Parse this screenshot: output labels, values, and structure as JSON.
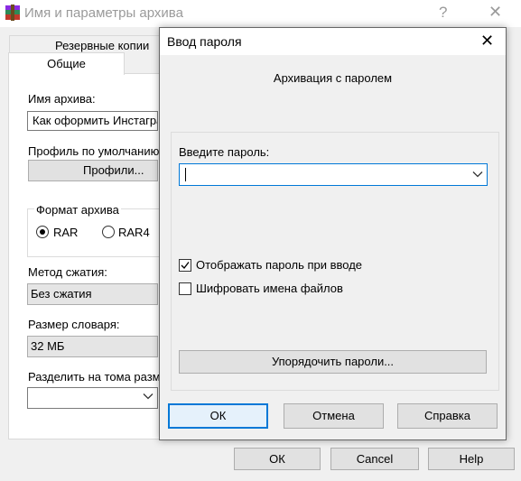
{
  "background_dialog": {
    "title": "Имя и параметры архива",
    "help_glyph": "?",
    "close_glyph": "✕",
    "tabs": [
      {
        "label": "Резервные копии"
      },
      {
        "label": "Общие"
      }
    ],
    "archive_name": {
      "label": "Имя архива:",
      "value": "Как оформить Инстагра"
    },
    "default_profile": {
      "label": "Профиль по умолчанию",
      "button_label": "Профили..."
    },
    "archive_format": {
      "label": "Формат архива",
      "options": [
        {
          "label": "RAR",
          "selected": true
        },
        {
          "label": "RAR4",
          "selected": false
        }
      ]
    },
    "compression_method": {
      "label": "Метод сжатия:",
      "value": "Без сжатия"
    },
    "dictionary_size": {
      "label": "Размер словаря:",
      "value": "32 МБ"
    },
    "split_volumes": {
      "label": "Разделить на тома разме",
      "value": ""
    },
    "buttons": {
      "ok": "ОК",
      "cancel": "Cancel",
      "help": "Help"
    }
  },
  "password_dialog": {
    "title": "Ввод пароля",
    "close_glyph": "✕",
    "subtitle": "Архивация с паролем",
    "password_field": {
      "label": "Введите пароль:",
      "value": ""
    },
    "checkboxes": [
      {
        "label": "Отображать пароль при вводе",
        "checked": true
      },
      {
        "label": "Шифровать имена файлов",
        "checked": false
      }
    ],
    "organize_button_label": "Упорядочить пароли...",
    "buttons": {
      "ok": "ОК",
      "cancel": "Отмена",
      "help": "Справка"
    }
  },
  "colors": {
    "accent": "#0078d7",
    "window_bg": "#f0f0f0",
    "button_bg": "#e1e1e1",
    "inactive_title": "#9a9a9a"
  },
  "icons": {
    "app": "winrar-icon",
    "close": "close-icon",
    "help": "help-icon",
    "dropdown": "chevron-down-icon",
    "check": "checkmark-icon"
  }
}
